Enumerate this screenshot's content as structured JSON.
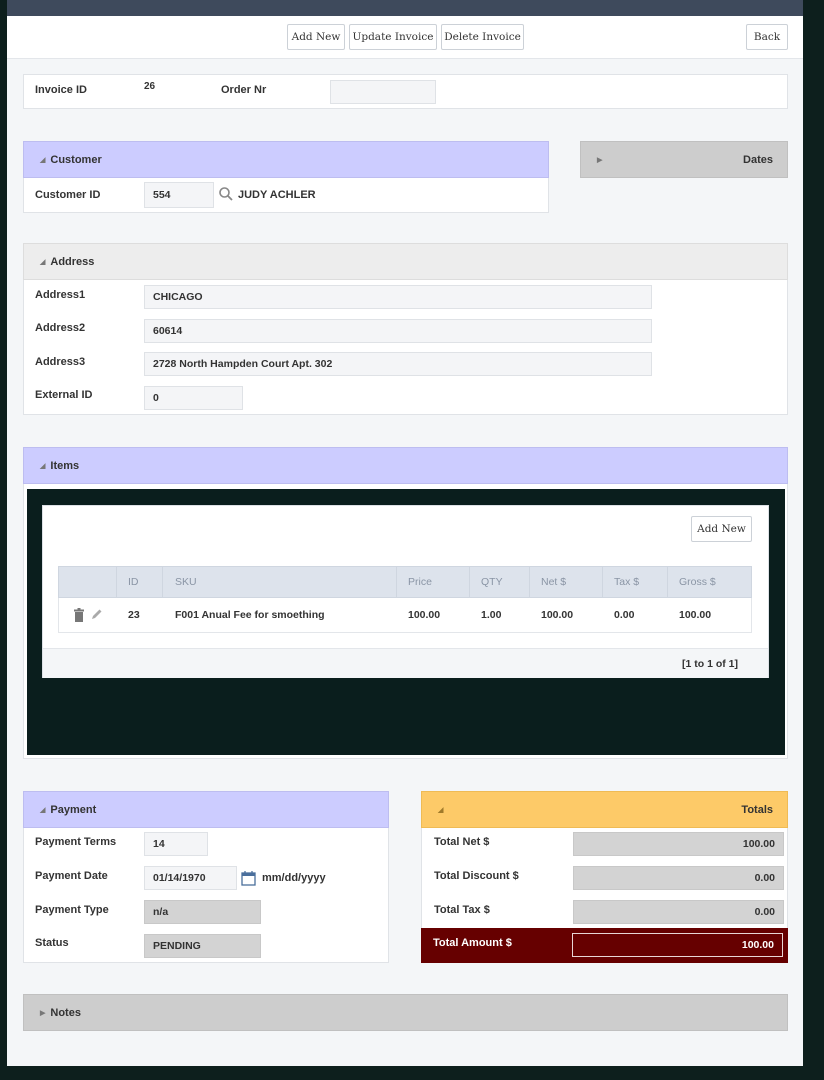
{
  "toolbar": {
    "add_new": "Add New",
    "update_invoice": "Update Invoice",
    "delete_invoice": "Delete Invoice",
    "back": "Back"
  },
  "invoice": {
    "id_label": "Invoice ID",
    "id_value": "26",
    "order_label": "Order Nr",
    "order_value": ""
  },
  "customer": {
    "header": "Customer",
    "id_label": "Customer ID",
    "id_value": "554",
    "name": "JUDY ACHLER"
  },
  "dates": {
    "header": "Dates"
  },
  "address": {
    "header": "Address",
    "address1_label": "Address1",
    "address1_value": "CHICAGO",
    "address2_label": "Address2",
    "address2_value": "60614",
    "address3_label": "Address3",
    "address3_value": "2728 North Hampden Court Apt. 302",
    "external_label": "External ID",
    "external_value": "0"
  },
  "items": {
    "header": "Items",
    "add_new": "Add New",
    "columns": [
      "ID",
      "SKU",
      "Price",
      "QTY",
      "Net $",
      "Tax $",
      "Gross $"
    ],
    "rows": [
      {
        "id": "23",
        "sku": "F001 Anual Fee for smoething",
        "price": "100.00",
        "qty": "1.00",
        "net": "100.00",
        "tax": "0.00",
        "gross": "100.00"
      }
    ],
    "pager": "[1 to 1 of 1]"
  },
  "payment": {
    "header": "Payment",
    "terms_label": "Payment Terms",
    "terms_value": "14",
    "date_label": "Payment Date",
    "date_value": "01/14/1970",
    "date_format": "mm/dd/yyyy",
    "type_label": "Payment Type",
    "type_value": "n/a",
    "status_label": "Status",
    "status_value": "PENDING"
  },
  "totals": {
    "header": "Totals",
    "net_label": "Total Net $",
    "net_value": "100.00",
    "discount_label": "Total Discount $",
    "discount_value": "0.00",
    "tax_label": "Total Tax $",
    "tax_value": "0.00",
    "amount_label": "Total Amount $",
    "amount_value": "100.00"
  },
  "notes": {
    "header": "Notes"
  },
  "colors": {
    "section_purple": "#ccccff",
    "section_gray": "#cdcdcd",
    "totals_yellow": "#fdca68",
    "total_amount_red": "#660000",
    "topbar": "#3e4a5c"
  },
  "icons": [
    "search-icon",
    "trash-icon",
    "pencil-icon",
    "calendar-icon",
    "triangle-expanded-icon",
    "triangle-collapsed-icon"
  ]
}
